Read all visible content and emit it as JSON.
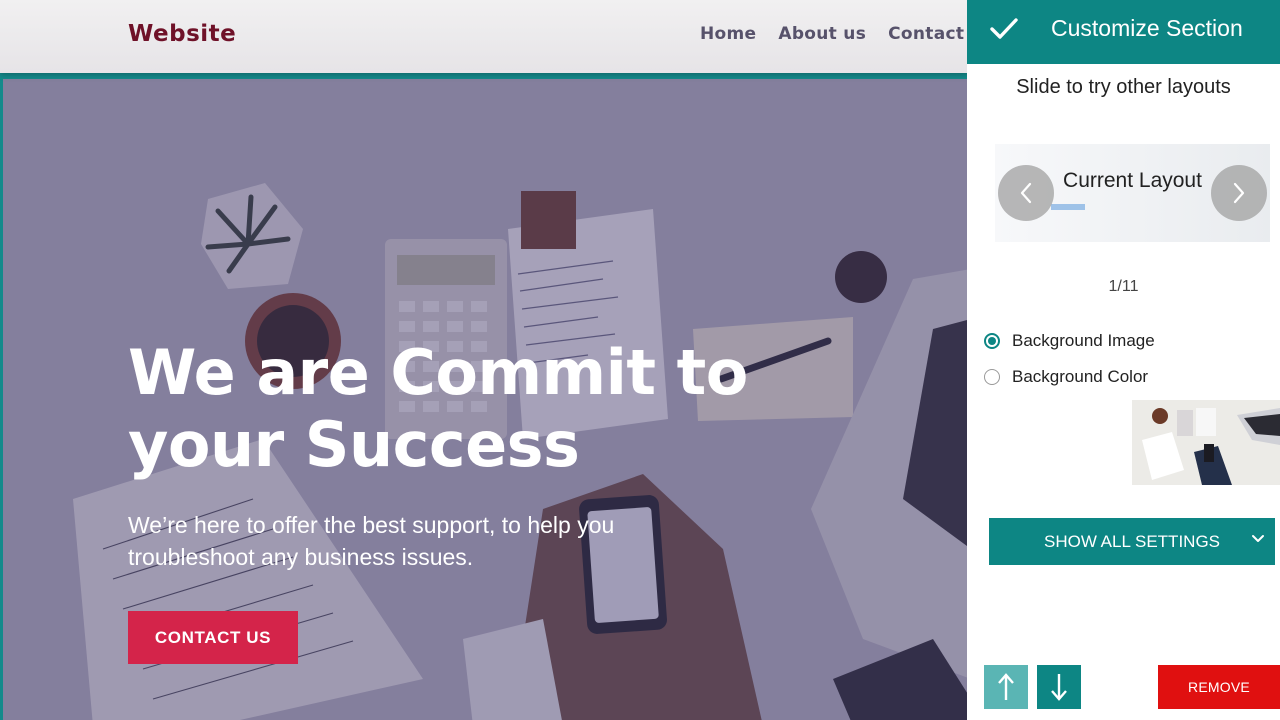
{
  "site": {
    "logo": "Website",
    "nav": [
      "Home",
      "About us",
      "Contact"
    ]
  },
  "hero": {
    "title": "We are Commit to your Success",
    "subtitle": "We’re here to offer the best support, to help you troubleshoot any business issues.",
    "cta": "CONTACT US"
  },
  "panel": {
    "title": "Customize Section",
    "hint": "Slide to try other layouts",
    "layout_label": "Current Layout",
    "counter": "1/11",
    "options": [
      "Background Image",
      "Background Color"
    ],
    "selected_option": "Background Image",
    "show_all": "SHOW ALL SETTINGS",
    "remove": "REMOVE"
  },
  "colors": {
    "accent": "#0d8684",
    "cta": "#d4244a",
    "remove": "#e01010",
    "logo": "#6f1128"
  },
  "icons": [
    "check-icon",
    "chevron-left-icon",
    "chevron-right-icon",
    "chevron-down-icon",
    "arrow-up-icon",
    "arrow-down-icon"
  ]
}
